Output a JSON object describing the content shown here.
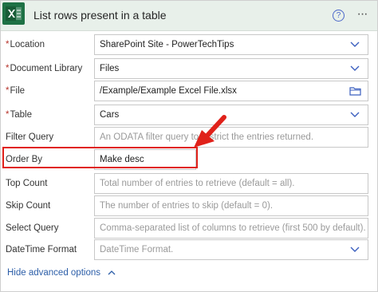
{
  "header": {
    "title": "List rows present in a table",
    "help_icon": "?",
    "more_icon": "···"
  },
  "fields": [
    {
      "key": "location",
      "label": "Location",
      "required": "*",
      "value": "SharePoint Site - PowerTechTips",
      "control": "chevron-down-icon"
    },
    {
      "key": "document_library",
      "label": "Document Library",
      "required": "*",
      "value": "Files",
      "control": "chevron-down-icon"
    },
    {
      "key": "file",
      "label": "File",
      "required": "*",
      "value": "/Example/Example Excel File.xlsx",
      "control": "folder-icon"
    },
    {
      "key": "table",
      "label": "Table",
      "required": "*",
      "value": "Cars",
      "control": "chevron-down-icon"
    },
    {
      "key": "filter_query",
      "label": "Filter Query",
      "placeholder": "An ODATA filter query to restrict the entries returned."
    },
    {
      "key": "order_by",
      "label": "Order By",
      "value": "Make desc"
    },
    {
      "key": "top_count",
      "label": "Top Count",
      "placeholder": "Total number of entries to retrieve (default = all)."
    },
    {
      "key": "skip_count",
      "label": "Skip Count",
      "placeholder": "The number of entries to skip (default = 0)."
    },
    {
      "key": "select_query",
      "label": "Select Query",
      "placeholder": "Comma-separated list of columns to retrieve (first 500 by default)."
    },
    {
      "key": "datetime_format",
      "label": "DateTime Format",
      "placeholder": "DateTime Format.",
      "control": "chevron-down-icon"
    }
  ],
  "footer": {
    "advanced_label": "Hide advanced options"
  },
  "colors": {
    "header_bg": "#e8f0ea",
    "excel_green": "#1e7145",
    "highlight_red": "#e0211a",
    "link_blue": "#2c5ea8",
    "chevron_blue": "#3b5fbf"
  }
}
